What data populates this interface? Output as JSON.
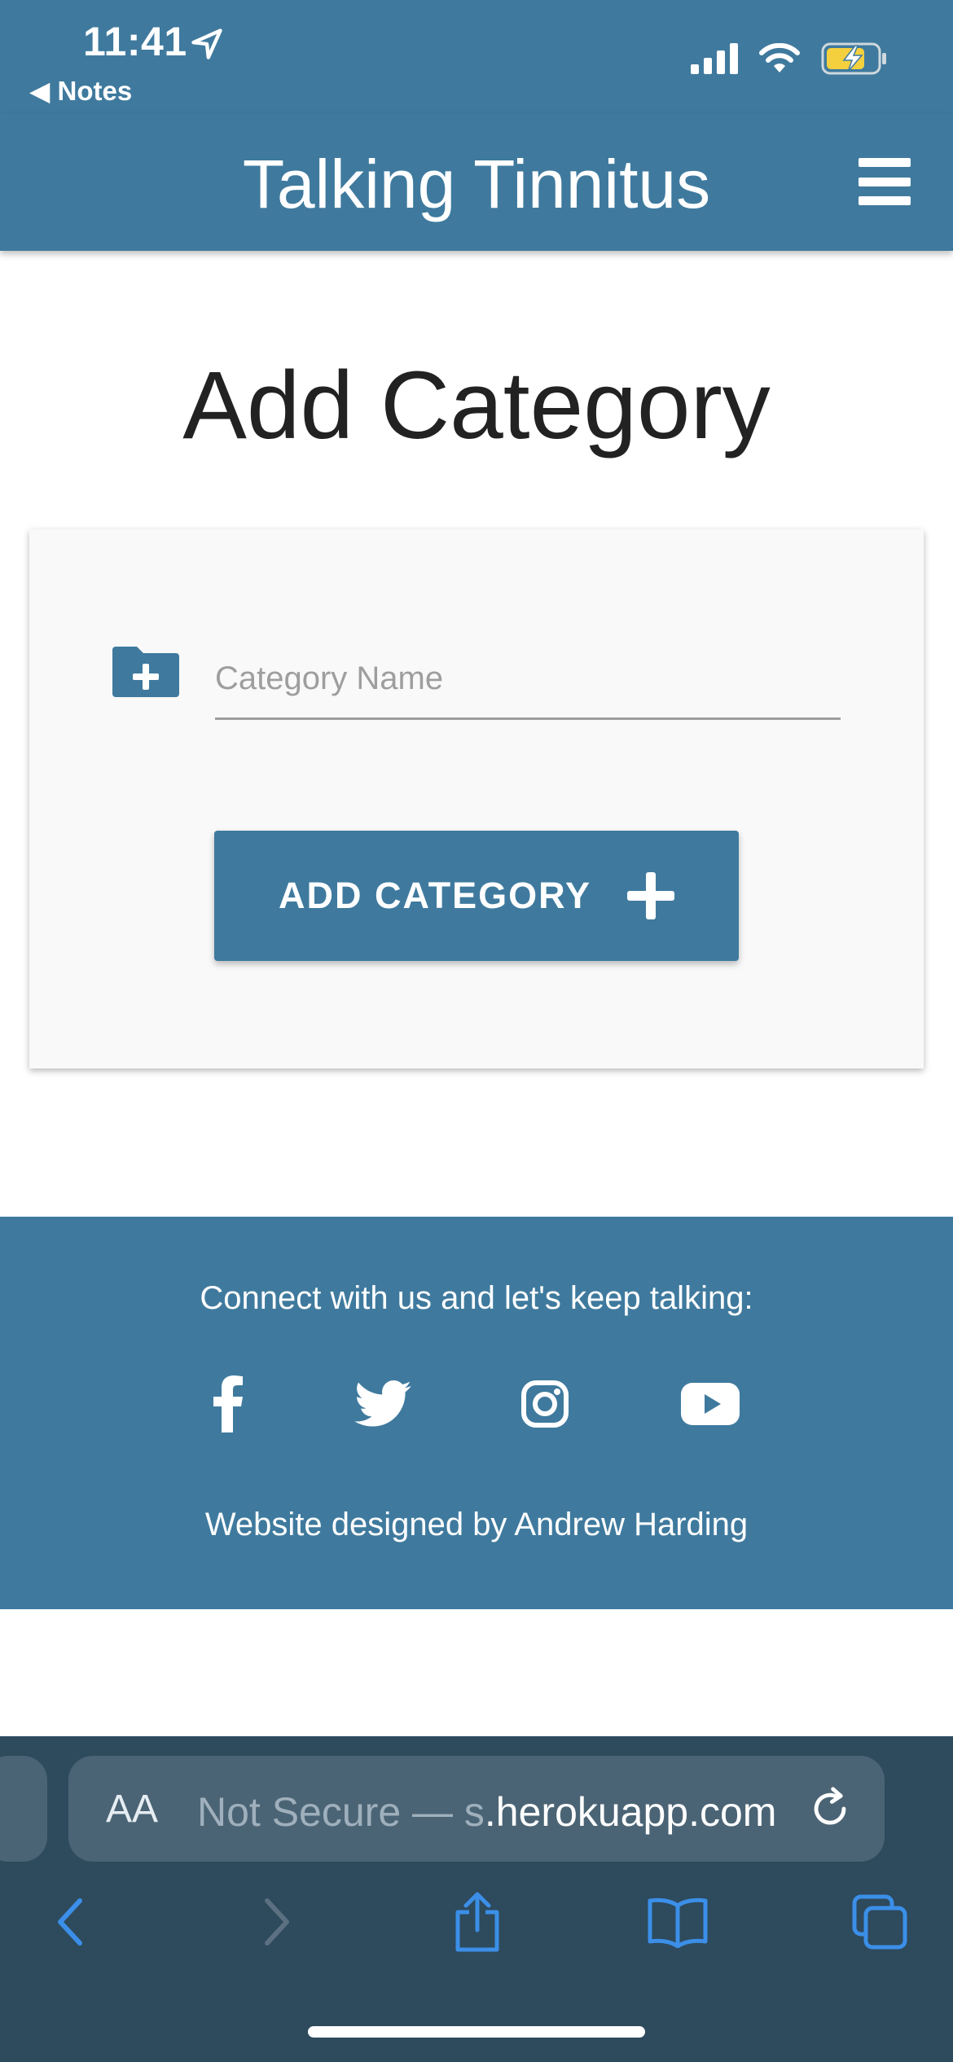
{
  "status_bar": {
    "time": "11:41",
    "back_label": "◀ Notes",
    "icons": [
      "location-arrow-icon",
      "cellular-signal-icon",
      "wifi-icon",
      "battery-charging-icon"
    ]
  },
  "nav": {
    "brand": "Talking Tinnitus",
    "menu_icon": "hamburger-menu-icon"
  },
  "main": {
    "title": "Add Category",
    "form": {
      "field_icon": "folder-plus-icon",
      "category_name_value": "",
      "category_name_placeholder": "Category Name",
      "submit_label": "ADD CATEGORY",
      "submit_icon": "plus-icon"
    }
  },
  "footer": {
    "connect_text": "Connect with us and let's keep talking:",
    "social_links": [
      "facebook-icon",
      "twitter-icon",
      "instagram-icon",
      "youtube-icon"
    ],
    "credit": "Website designed by Andrew Harding"
  },
  "browser": {
    "text_size_label": "AA",
    "url_dim": "Not Secure — ",
    "url_faded": "s",
    "url_main": ".herokuapp.com",
    "toolbar": [
      "back-icon",
      "forward-icon",
      "share-icon",
      "bookmarks-icon",
      "tabs-icon"
    ]
  },
  "colors": {
    "primary": "#3f7a9e",
    "safari_bar": "#2e4a5d",
    "safari_accent": "#3b8fe8",
    "battery_fill": "#f4d03f"
  }
}
